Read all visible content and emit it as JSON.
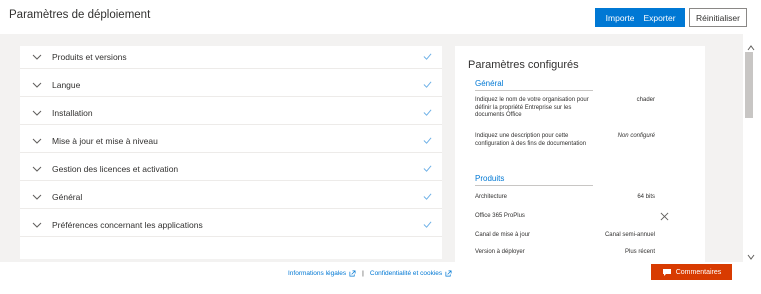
{
  "header": {
    "title": "Paramètres de déploiement",
    "import_label": "Importer",
    "export_label": "Exporter",
    "reset_label": "Réinitialiser"
  },
  "accordion": {
    "items": [
      {
        "label": "Produits et versions"
      },
      {
        "label": "Langue"
      },
      {
        "label": "Installation"
      },
      {
        "label": "Mise à jour et mise à niveau"
      },
      {
        "label": "Gestion des licences et activation"
      },
      {
        "label": "Général"
      },
      {
        "label": "Préférences concernant les applications"
      }
    ]
  },
  "configured": {
    "title": "Paramètres configurés",
    "general": {
      "heading": "Général",
      "rows": [
        {
          "label": "Indiquez le nom de votre organisation pour définir la propriété Entreprise sur les documents Office",
          "value": "chader"
        },
        {
          "label": "Indiquez une description pour cette configuration à des fins de documentation",
          "value": "Non configuré"
        }
      ]
    },
    "products": {
      "heading": "Produits",
      "rows": [
        {
          "label": "Architecture",
          "value": "64 bits"
        },
        {
          "label": "Office 365 ProPlus",
          "value": ""
        },
        {
          "label": "Canal de mise à jour",
          "value": "Canal semi-annuel"
        },
        {
          "label": "Version à déployer",
          "value": "Plus récent"
        }
      ]
    }
  },
  "footer": {
    "legal": "Informations légales",
    "separator": "|",
    "privacy": "Confidentialité et cookies",
    "feedback": "Commentaires"
  },
  "colors": {
    "accent": "#0078d4",
    "check": "#69aee6",
    "feedback": "#d83b01",
    "background": "#f3f2f1"
  },
  "icons": [
    "chevron-down-icon",
    "checkmark-icon",
    "close-icon",
    "external-link-icon",
    "comment-icon",
    "scroll-up-icon",
    "scroll-down-icon"
  ]
}
